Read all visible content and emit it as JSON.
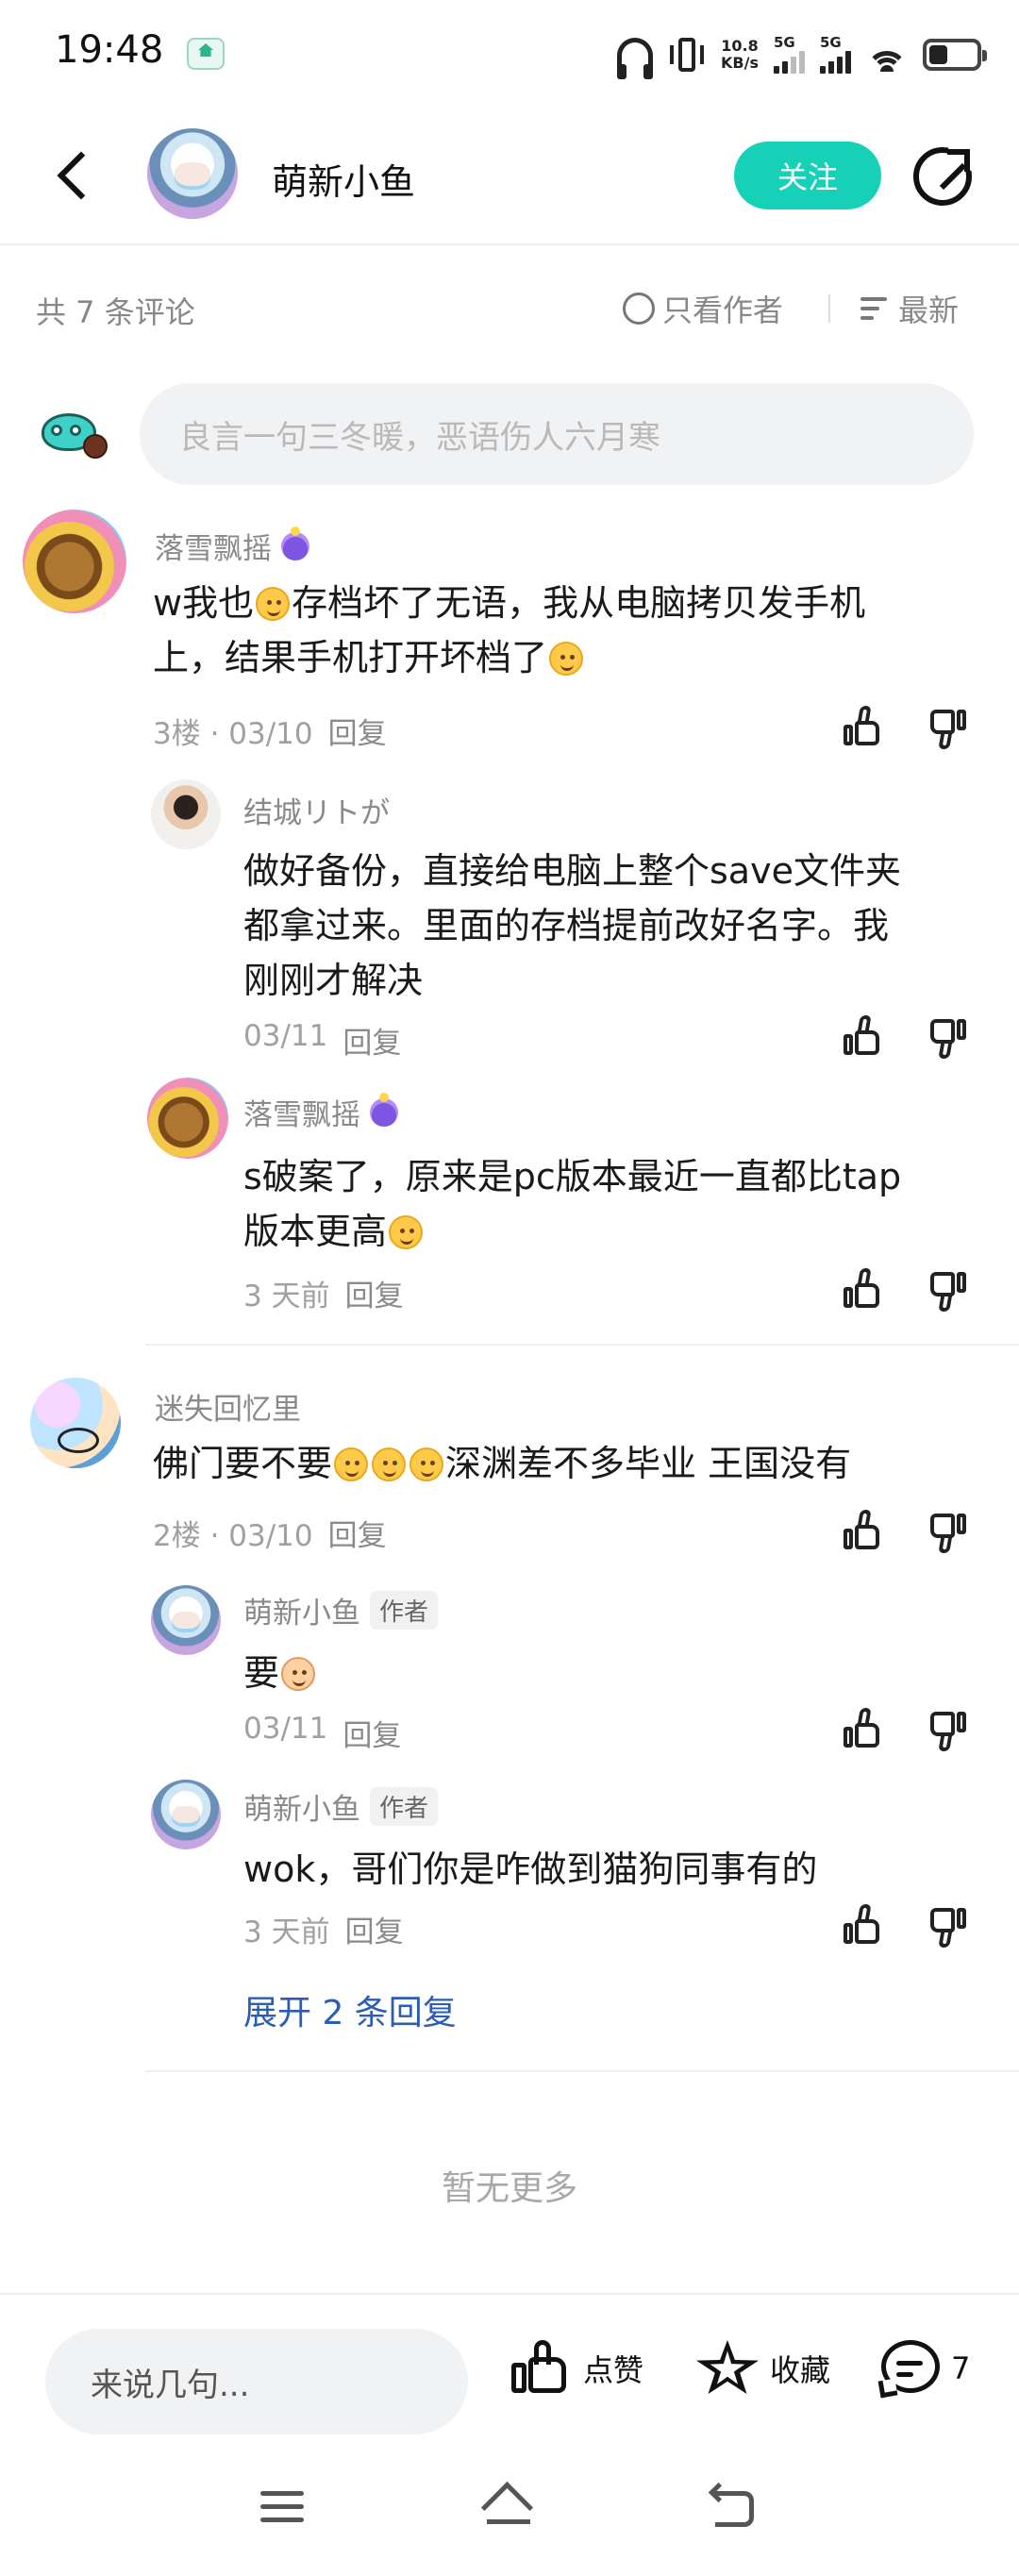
{
  "status_bar": {
    "time": "19:48",
    "speed_value": "10.8",
    "speed_unit": "KB/s",
    "sig1": "5G",
    "sig2": "5G"
  },
  "header": {
    "user_name": "萌新小鱼",
    "follow_label": "关注"
  },
  "filter": {
    "count_text": "共 7 条评论",
    "only_author_label": "只看作者",
    "sort_label": "最新"
  },
  "comment_input": {
    "placeholder": "良言一句三冬暖，恶语伤人六月寒"
  },
  "comments": [
    {
      "user": "落雪飘摇",
      "text_a": "w我也",
      "text_b": "存档坏了无语，我从电脑拷贝发手机",
      "text_c": "上，结果手机打开坏档了",
      "meta_floor": "3楼 · 03/10",
      "reply_label": "回复",
      "replies": [
        {
          "user": "结城リトが",
          "line1": "做好备份，直接给电脑上整个save文件夹",
          "line2": "都拿过来。里面的存档提前改好名字。我",
          "line3": "刚刚才解决",
          "date": "03/11",
          "reply_label": "回复"
        },
        {
          "user": "落雪飘摇",
          "line1": "s破案了，原来是pc版本最近一直都比tap",
          "line2": "版本更高",
          "date": "3 天前",
          "reply_label": "回复"
        }
      ]
    },
    {
      "user": "迷失回忆里",
      "text_a": "佛门要不要",
      "text_b": "深渊差不多毕业 王国没有",
      "meta_floor": "2楼 · 03/10",
      "reply_label": "回复",
      "replies": [
        {
          "user": "萌新小鱼",
          "tag": "作者",
          "line1": "要",
          "date": "03/11",
          "reply_label": "回复"
        },
        {
          "user": "萌新小鱼",
          "tag": "作者",
          "line1": "wok，哥们你是咋做到猫狗同事有的",
          "date": "3 天前",
          "reply_label": "回复"
        }
      ],
      "expand_label": "展开 2 条回复"
    }
  ],
  "no_more_text": "暂无更多",
  "bottom_bar": {
    "input_placeholder": "来说几句...",
    "like_label": "点赞",
    "favorite_label": "收藏",
    "comment_count": "7"
  },
  "colors": {
    "accent": "#16d1b7",
    "link": "#2a5db5"
  }
}
